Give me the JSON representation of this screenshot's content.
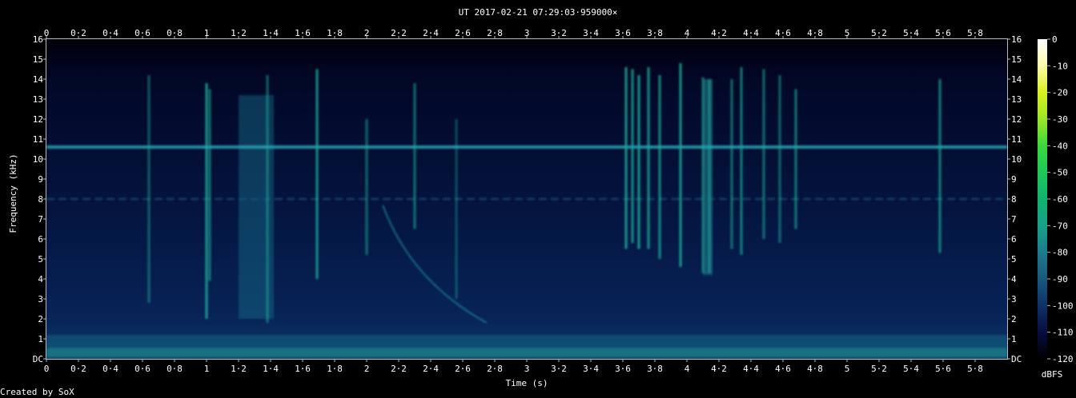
{
  "chart_data": {
    "type": "heatmap",
    "title": "UT 2017-02-21 07:29:03·959000×",
    "xlabel": "Time (s)",
    "ylabel": "Frequency (kHz)",
    "xlim": [
      0,
      6.0
    ],
    "ylim": [
      0,
      16
    ],
    "x_ticks": [
      "0",
      "0·2",
      "0·4",
      "0·6",
      "0·8",
      "1",
      "1·2",
      "1·4",
      "1·6",
      "1·8",
      "2",
      "2·2",
      "2·4",
      "2·6",
      "2·8",
      "3",
      "3·2",
      "3·4",
      "3·6",
      "3·8",
      "4",
      "4·2",
      "4·4",
      "4·6",
      "4·8",
      "5",
      "5·2",
      "5·4",
      "5·6",
      "5·8"
    ],
    "y_ticks": [
      "DC",
      "1",
      "2",
      "3",
      "4",
      "5",
      "6",
      "7",
      "8",
      "9",
      "10",
      "11",
      "12",
      "13",
      "14",
      "15",
      "16"
    ],
    "colorbar": {
      "unit": "dBFS",
      "range": [
        -120,
        0
      ],
      "ticks": [
        "0",
        "-10",
        "-20",
        "-30",
        "-40",
        "-50",
        "-60",
        "-70",
        "-80",
        "-90",
        "-100",
        "-110",
        "-120"
      ],
      "colors": [
        "#ffffff",
        "#fcfca8",
        "#d8f020",
        "#9be628",
        "#3cd83c",
        "#1ec85a",
        "#10b46e",
        "#18a08a",
        "#1c7c8c",
        "#18587e",
        "#0e3268",
        "#080c40",
        "#000000"
      ]
    },
    "features": {
      "tone_khz": 10.6,
      "faint_tone_khz": 8.0,
      "noise_floor_khz": [
        0,
        1.2
      ],
      "sweep": {
        "t_start": 2.1,
        "f_start": 7.7,
        "t_end": 2.75,
        "f_end": 1.8
      },
      "impulses": [
        {
          "t": 0.64,
          "f_top": 14.2,
          "f_bottom": 2.8,
          "level": 0.5
        },
        {
          "t": 1.0,
          "f_top": 13.8,
          "f_bottom": 2.0,
          "level": 0.85
        },
        {
          "t": 1.02,
          "f_top": 13.5,
          "f_bottom": 3.9,
          "level": 0.6
        },
        {
          "t": 1.38,
          "f_top": 14.2,
          "f_bottom": 1.8,
          "level": 0.55
        },
        {
          "t": 1.69,
          "f_top": 14.5,
          "f_bottom": 4.0,
          "level": 0.8
        },
        {
          "t": 2.0,
          "f_top": 12.0,
          "f_bottom": 5.2,
          "level": 0.55
        },
        {
          "t": 2.3,
          "f_top": 13.8,
          "f_bottom": 6.5,
          "level": 0.6
        },
        {
          "t": 2.56,
          "f_top": 12.0,
          "f_bottom": 3.0,
          "level": 0.4
        },
        {
          "t": 3.62,
          "f_top": 14.6,
          "f_bottom": 5.5,
          "level": 0.85
        },
        {
          "t": 3.66,
          "f_top": 14.5,
          "f_bottom": 5.8,
          "level": 0.8
        },
        {
          "t": 3.7,
          "f_top": 14.2,
          "f_bottom": 5.5,
          "level": 0.85
        },
        {
          "t": 3.76,
          "f_top": 14.6,
          "f_bottom": 5.5,
          "level": 0.8
        },
        {
          "t": 3.83,
          "f_top": 14.2,
          "f_bottom": 5.0,
          "level": 0.75
        },
        {
          "t": 3.96,
          "f_top": 14.8,
          "f_bottom": 4.6,
          "level": 0.85
        },
        {
          "t": 4.1,
          "f_top": 14.1,
          "f_bottom": 4.3,
          "level": 0.6
        },
        {
          "t": 4.14,
          "f_top": 14.0,
          "f_bottom": 4.3,
          "level": 0.55
        },
        {
          "t": 4.28,
          "f_top": 14.0,
          "f_bottom": 5.5,
          "level": 0.6
        },
        {
          "t": 4.34,
          "f_top": 14.6,
          "f_bottom": 5.2,
          "level": 0.7
        },
        {
          "t": 4.48,
          "f_top": 14.5,
          "f_bottom": 6.0,
          "level": 0.6
        },
        {
          "t": 4.58,
          "f_top": 14.2,
          "f_bottom": 5.8,
          "level": 0.55
        },
        {
          "t": 4.68,
          "f_top": 13.5,
          "f_bottom": 6.5,
          "level": 0.65
        },
        {
          "t": 5.58,
          "f_top": 14.0,
          "f_bottom": 5.3,
          "level": 0.7
        }
      ],
      "band": {
        "t_start": 1.2,
        "t_end": 1.42,
        "f_top": 13.2,
        "f_bottom": 2.0
      },
      "band2": {
        "t_start": 4.1,
        "t_end": 4.16,
        "f_top": 14.0,
        "f_bottom": 4.2
      }
    }
  },
  "footer": {
    "credit": "Created by SoX"
  }
}
